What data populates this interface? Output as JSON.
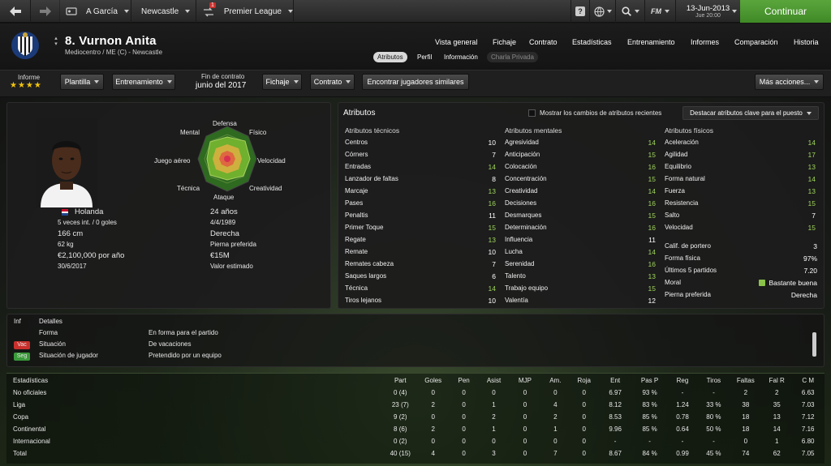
{
  "topbar": {
    "manager": "A García",
    "club": "Newcastle",
    "competition": "Premier League",
    "notif_count": "1",
    "date": "13-Jun-2013",
    "weekday_time": "Jue 20:00",
    "continue_label": "Continuar",
    "fm_label": "FM"
  },
  "player": {
    "name": "8. Vurnon Anita",
    "subtitle": "Mediocentro / ME (C) - Newcastle"
  },
  "nav": [
    "Vista general",
    "Fichaje",
    "Contrato",
    "Estadísticas",
    "Entrenamiento",
    "Informes",
    "Comparación",
    "Historia"
  ],
  "subtabs": [
    "Atributos",
    "Perfil",
    "Información",
    "Charla Privada"
  ],
  "toolbar": {
    "report_label": "Informe",
    "stars": "★★★★",
    "squad_btn": "Plantilla",
    "training_btn": "Entrenamiento",
    "contract_end_label": "Fin de contrato",
    "contract_end_value": "junio del 2017",
    "transfer_btn": "Fichaje",
    "contract_btn": "Contrato",
    "similar_btn": "Encontrar jugadores similares",
    "more_btn": "Más acciones..."
  },
  "radar": {
    "top": "Defensa",
    "top_right": "Físico",
    "top_left": "Mental",
    "right": "Velocidad",
    "left": "Juego aéreo",
    "bottom_right": "Creatividad",
    "bottom_left": "Técnica",
    "bottom": "Ataque"
  },
  "bio": {
    "nationality": "Holanda",
    "caps": "5 veces int. / 0 goles",
    "height": "166 cm",
    "weight": "62 kg",
    "wage": "€2,100,000 por año",
    "contract": "30/6/2017",
    "age": "24 años",
    "dob": "4/4/1989",
    "foot": "Derecha",
    "foot_label": "Pierna preferida",
    "value": "€15M",
    "value_label": "Valor estimado"
  },
  "attributes": {
    "title": "Atributos",
    "show_changes": "Mostrar los cambios de atributos recientes",
    "highlight": "Destacar atributos clave para el puesto",
    "technical_title": "Atributos técnicos",
    "mental_title": "Atributos mentales",
    "physical_title": "Atributos físicos",
    "technical": [
      [
        "Centros",
        "10"
      ],
      [
        "Córners",
        "7"
      ],
      [
        "Entradas",
        "14"
      ],
      [
        "Lanzador de faltas",
        "8"
      ],
      [
        "Marcaje",
        "13"
      ],
      [
        "Pases",
        "16"
      ],
      [
        "Penaltis",
        "11"
      ],
      [
        "Primer Toque",
        "15"
      ],
      [
        "Regate",
        "13"
      ],
      [
        "Remate",
        "10"
      ],
      [
        "Remates cabeza",
        "7"
      ],
      [
        "Saques largos",
        "6"
      ],
      [
        "Técnica",
        "14"
      ],
      [
        "Tiros lejanos",
        "10"
      ]
    ],
    "mental": [
      [
        "Agresividad",
        "14"
      ],
      [
        "Anticipación",
        "15"
      ],
      [
        "Colocación",
        "16"
      ],
      [
        "Concentración",
        "15"
      ],
      [
        "Creatividad",
        "14"
      ],
      [
        "Decisiones",
        "16"
      ],
      [
        "Desmarques",
        "15"
      ],
      [
        "Determinación",
        "16"
      ],
      [
        "Influencia",
        "11"
      ],
      [
        "Lucha",
        "14"
      ],
      [
        "Serenidad",
        "16"
      ],
      [
        "Talento",
        "13"
      ],
      [
        "Trabajo equipo",
        "15"
      ],
      [
        "Valentía",
        "12"
      ]
    ],
    "physical": [
      [
        "Aceleración",
        "14"
      ],
      [
        "Agilidad",
        "17"
      ],
      [
        "Equilibrio",
        "13"
      ],
      [
        "Forma natural",
        "14"
      ],
      [
        "Fuerza",
        "13"
      ],
      [
        "Resistencia",
        "15"
      ],
      [
        "Salto",
        "7"
      ],
      [
        "Velocidad",
        "15"
      ]
    ],
    "extra": [
      [
        "Calif. de portero",
        "3"
      ],
      [
        "Forma física",
        "97%"
      ],
      [
        "Últimos 5 partidos",
        "7.20"
      ],
      [
        "Moral",
        "Bastante buena"
      ],
      [
        "Pierna preferida",
        "Derecha"
      ]
    ]
  },
  "details": {
    "inf_header": "Inf",
    "det_header": "Detalles",
    "rows": [
      [
        "",
        "Forma",
        "En forma para el partido"
      ],
      [
        "Vac",
        "Situación",
        "De vacaciones"
      ],
      [
        "Seg",
        "Situación de jugador",
        "Pretendido por un equipo"
      ]
    ]
  },
  "stats": {
    "headers": [
      "Estadísticas",
      "Part",
      "Goles",
      "Pen",
      "Asist",
      "MJP",
      "Am.",
      "Roja",
      "Ent",
      "Pas P",
      "Reg",
      "Tiros",
      "Faltas",
      "Fal R",
      "C M"
    ],
    "rows": [
      [
        "No oficiales",
        "0 (4)",
        "0",
        "0",
        "0",
        "0",
        "0",
        "0",
        "6.97",
        "93 %",
        "-",
        "-",
        "2",
        "2",
        "6.63"
      ],
      [
        "Liga",
        "23 (7)",
        "2",
        "0",
        "1",
        "0",
        "4",
        "0",
        "8.12",
        "83 %",
        "1.24",
        "33 %",
        "38",
        "35",
        "7.03"
      ],
      [
        "Copa",
        "9 (2)",
        "0",
        "0",
        "2",
        "0",
        "2",
        "0",
        "8.53",
        "85 %",
        "0.78",
        "80 %",
        "18",
        "13",
        "7.12"
      ],
      [
        "Continental",
        "8 (6)",
        "2",
        "0",
        "1",
        "0",
        "1",
        "0",
        "9.96",
        "85 %",
        "0.64",
        "50 %",
        "18",
        "14",
        "7.16"
      ],
      [
        "Internacional",
        "0 (2)",
        "0",
        "0",
        "0",
        "0",
        "0",
        "0",
        "-",
        "-",
        "-",
        "-",
        "0",
        "1",
        "6.80"
      ],
      [
        "Total",
        "40 (15)",
        "4",
        "0",
        "3",
        "0",
        "7",
        "0",
        "8.67",
        "84 %",
        "0.99",
        "45 %",
        "74",
        "62",
        "7.05"
      ]
    ]
  }
}
